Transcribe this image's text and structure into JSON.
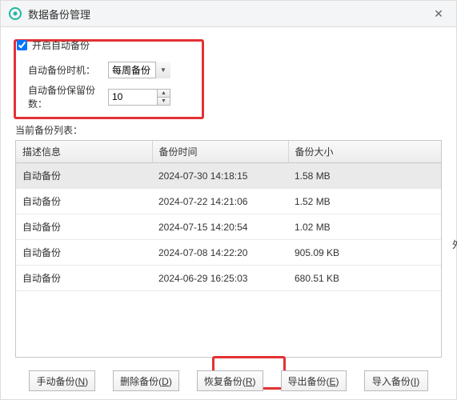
{
  "title": "数据备份管理",
  "close_glyph": "✕",
  "checkbox_label": "开启自动备份",
  "checkbox_checked": true,
  "timing_label": "自动备份时机：",
  "timing_value": "每周备份",
  "keep_label": "自动备份保留份数：",
  "keep_value": "10",
  "list_label": "当前备份列表：",
  "headers": {
    "desc": "描述信息",
    "time": "备份时间",
    "size": "备份大小"
  },
  "rows": [
    {
      "desc": "自动备份",
      "time": "2024-07-30 14:18:15",
      "size": "1.58 MB",
      "selected": true
    },
    {
      "desc": "自动备份",
      "time": "2024-07-22 14:21:06",
      "size": "1.52 MB",
      "selected": false
    },
    {
      "desc": "自动备份",
      "time": "2024-07-15 14:20:54",
      "size": "1.02 MB",
      "selected": false
    },
    {
      "desc": "自动备份",
      "time": "2024-07-08 14:22:20",
      "size": "905.09 KB",
      "selected": false
    },
    {
      "desc": "自动备份",
      "time": "2024-06-29 16:25:03",
      "size": "680.51 KB",
      "selected": false
    }
  ],
  "buttons": {
    "manual": {
      "text": "手动备份(",
      "accel": "N",
      "tail": ")"
    },
    "delete": {
      "text": "删除备份(",
      "accel": "D",
      "tail": ")"
    },
    "restore": {
      "text": "恢复备份(",
      "accel": "R",
      "tail": ")"
    },
    "export": {
      "text": "导出备份(",
      "accel": "E",
      "tail": ")"
    },
    "import": {
      "text": "导入备份(",
      "accel": "I",
      "tail": ")"
    }
  },
  "stray_char": "外"
}
